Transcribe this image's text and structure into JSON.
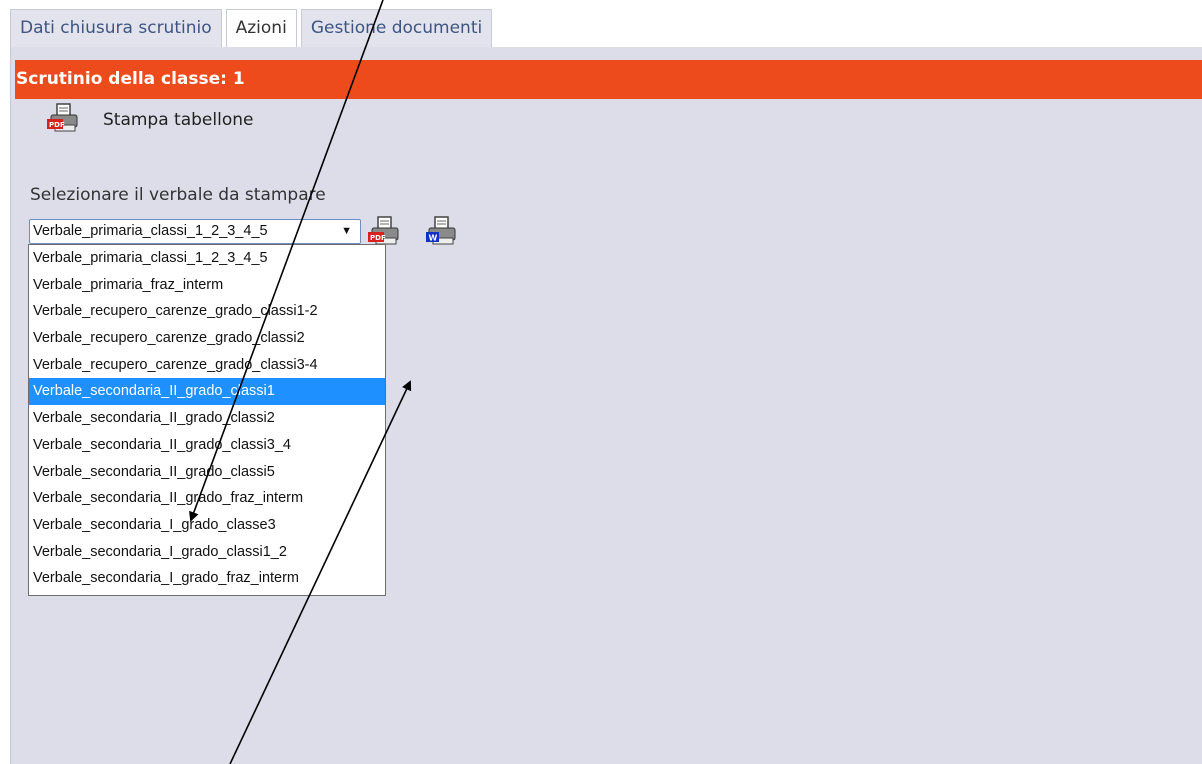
{
  "tabs": [
    {
      "label": "Dati chiusura scrutinio"
    },
    {
      "label": "Azioni"
    },
    {
      "label": "Gestione documenti"
    }
  ],
  "panel": {
    "title": "Scrutinio della classe: 1"
  },
  "stampa": {
    "label": "Stampa tabellone",
    "icon": "pdf-print-icon"
  },
  "verbale": {
    "label": "Selezionare il verbale da stampare",
    "selected_value": "Verbale_primaria_classi_1_2_3_4_5",
    "arrow": "▼",
    "options": [
      {
        "label": "Verbale_primaria_classi_1_2_3_4_5"
      },
      {
        "label": "Verbale_primaria_fraz_interm"
      },
      {
        "label": "Verbale_recupero_carenze_grado_classi1-2"
      },
      {
        "label": "Verbale_recupero_carenze_grado_classi2"
      },
      {
        "label": "Verbale_recupero_carenze_grado_classi3-4"
      },
      {
        "label": "Verbale_secondaria_II_grado_classi1"
      },
      {
        "label": "Verbale_secondaria_II_grado_classi2"
      },
      {
        "label": "Verbale_secondaria_II_grado_classi3_4"
      },
      {
        "label": "Verbale_secondaria_II_grado_classi5"
      },
      {
        "label": "Verbale_secondaria_II_grado_fraz_interm"
      },
      {
        "label": "Verbale_secondaria_I_grado_classe3"
      },
      {
        "label": "Verbale_secondaria_I_grado_classi1_2"
      },
      {
        "label": "Verbale_secondaria_I_grado_fraz_interm"
      }
    ],
    "highlighted_option": "Verbale_secondaria_II_grado_classi1"
  },
  "colors": {
    "header": "#ee4b1c",
    "panel_bg": "#dcdde9",
    "highlight": "#1e90ff"
  }
}
